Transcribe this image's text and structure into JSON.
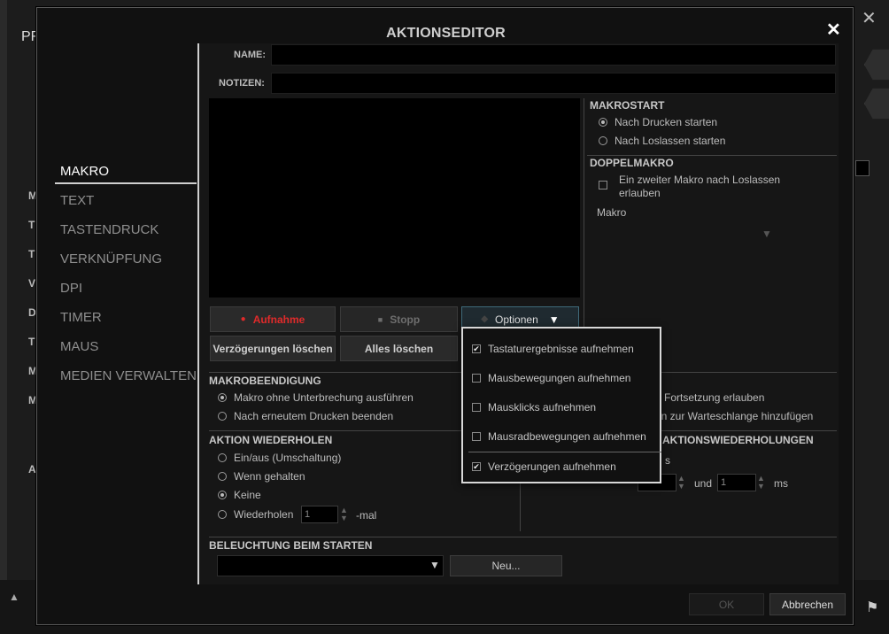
{
  "background": {
    "tab_fragment": "PR",
    "left_letters": [
      "M",
      "T",
      "T",
      "V",
      "D",
      "T",
      "M",
      "M",
      "A"
    ],
    "close_glyph": "✕",
    "up_arrow": "▲"
  },
  "dialog": {
    "title": "AKTIONSEDITOR",
    "close_glyph": "✕"
  },
  "nav": {
    "items": [
      {
        "label": "MAKRO",
        "active": true
      },
      {
        "label": "TEXT",
        "active": false
      },
      {
        "label": "TASTENDRUCK",
        "active": false
      },
      {
        "label": "VERKNÜPFUNG",
        "active": false
      },
      {
        "label": "DPI",
        "active": false
      },
      {
        "label": "TIMER",
        "active": false
      },
      {
        "label": "MAUS",
        "active": false
      },
      {
        "label": "MEDIEN VERWALTEN",
        "active": false
      }
    ]
  },
  "form": {
    "name_label": "NAME:",
    "name_value": "",
    "notes_label": "NOTIZEN:",
    "notes_value": ""
  },
  "record_buttons": {
    "record": "Aufnahme",
    "stop": "Stopp",
    "options": "Optionen",
    "clear_delays": "Verzögerungen löschen",
    "clear_all": "Alles löschen"
  },
  "options_menu": {
    "items": [
      {
        "label": "Tastaturergebnisse aufnehmen",
        "checked": true
      },
      {
        "label": "Mausbewegungen aufnehmen",
        "checked": false
      },
      {
        "label": "Mausklicks aufnehmen",
        "checked": false
      },
      {
        "label": "Mausradbewegungen aufnehmen",
        "checked": false
      },
      {
        "label": "Verzögerungen aufnehmen",
        "checked": true
      }
    ]
  },
  "macro_start": {
    "title": "MAKROSTART",
    "options": [
      {
        "label": "Nach Drucken starten",
        "selected": true
      },
      {
        "label": "Nach Loslassen starten",
        "selected": false
      }
    ]
  },
  "double_macro": {
    "title": "DOPPELMAKRO",
    "checkbox_label_line1": "Ein zweiter Makro nach Loslassen",
    "checkbox_label_line2": "erlauben",
    "checked": false,
    "macro_label": "Makro",
    "macro_value": ""
  },
  "macro_end": {
    "title": "MAKROBEENDIGUNG",
    "options": [
      {
        "label": "Makro ohne Unterbrechung ausführen",
        "selected": true
      },
      {
        "label": "Nach erneutem Drucken beenden",
        "selected": false
      }
    ]
  },
  "repeat_action": {
    "title": "AKTION WIEDERHOLEN",
    "options": [
      {
        "label": "Ein/aus (Umschaltung)",
        "selected": false
      },
      {
        "label": "Wenn gehalten",
        "selected": false
      },
      {
        "label": "Keine",
        "selected": true
      },
      {
        "label": "Wiederholen",
        "selected": false
      }
    ],
    "repeat_count": "1",
    "repeat_suffix": "-mal"
  },
  "right_partial": {
    "line1": "er Fortsetzung erlauben",
    "line2": "ren zur Warteschlange hinzufügen",
    "title_fragment": "AKTIONSWIEDERHOLUNGEN",
    "ms_fragment": "s",
    "and_label": "und",
    "value_b": "1",
    "unit": "ms"
  },
  "lighting": {
    "title": "BELEUCHTUNG BEIM STARTEN",
    "value": "",
    "new_button": "Neu..."
  },
  "footer": {
    "ok": "OK",
    "cancel": "Abbrechen"
  }
}
